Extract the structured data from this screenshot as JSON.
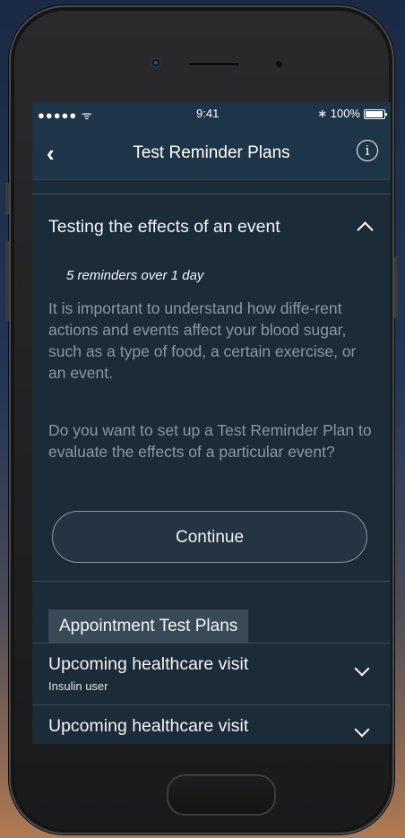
{
  "status_bar": {
    "signal": "●●●●● ᯤ",
    "time": "9:41",
    "battery": "∗ 100%"
  },
  "nav": {
    "back_icon": "‹",
    "title": "Test Reminder Plans",
    "info_icon": "i"
  },
  "event_plan": {
    "heading": "Testing the effects of an event",
    "subtitle": "5 reminders over 1 day",
    "description": "It is important to understand how diffe-rent actions and events affect your blood sugar, such as a type of food, a certain exercise, or an event.",
    "question": "Do you want to set up a Test Reminder Plan to evaluate the effects of a particular event?",
    "continue_label": "Continue"
  },
  "appointment_section": {
    "label": "Appointment Test Plans",
    "rows": [
      {
        "title": "Upcoming healthcare visit",
        "subtitle": "Insulin user"
      },
      {
        "title": "Upcoming healthcare visit",
        "subtitle": ""
      }
    ]
  }
}
